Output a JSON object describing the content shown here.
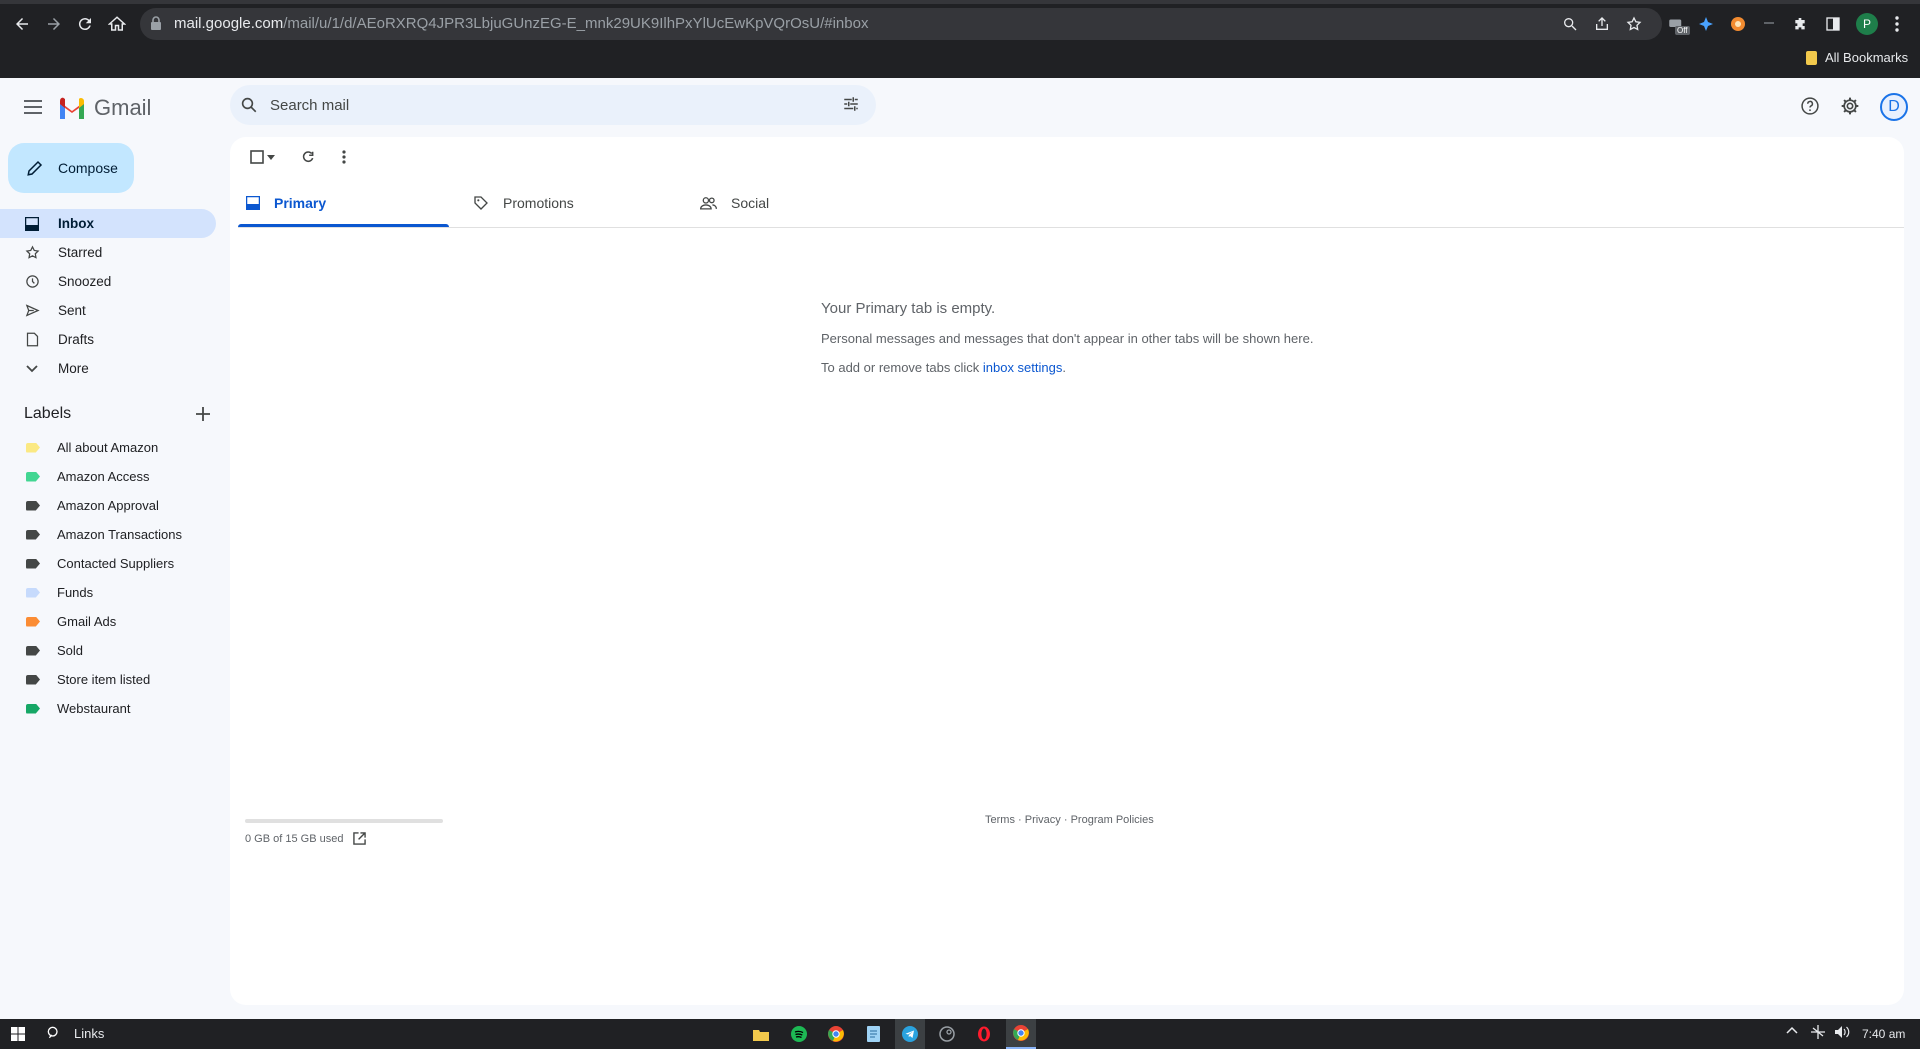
{
  "browser": {
    "url_host": "mail.google.com",
    "url_path": "/mail/u/1/d/AEoRXRQ4JPR3LbjuGUnzEG-E_mnk29UK9IlhPxYlUcEwKpVQrOsU/#inbox",
    "bookmarks_label": "All Bookmarks",
    "profile_initial": "P",
    "ext_badge": "Off"
  },
  "gmail": {
    "app_name": "Gmail",
    "search_placeholder": "Search mail",
    "account_initial": "D"
  },
  "sidebar": {
    "compose_label": "Compose",
    "items": [
      {
        "label": "Inbox",
        "icon": "inbox-icon",
        "active": true
      },
      {
        "label": "Starred",
        "icon": "star-icon"
      },
      {
        "label": "Snoozed",
        "icon": "clock-icon"
      },
      {
        "label": "Sent",
        "icon": "send-icon"
      },
      {
        "label": "Drafts",
        "icon": "draft-icon"
      },
      {
        "label": "More",
        "icon": "chevron-down-icon"
      }
    ],
    "labels_title": "Labels",
    "labels": [
      {
        "name": "All about Amazon",
        "color": "#fbe983"
      },
      {
        "name": "Amazon Access",
        "color": "#42d692"
      },
      {
        "name": "Amazon Approval",
        "color": "#444746"
      },
      {
        "name": "Amazon Transactions",
        "color": "#444746"
      },
      {
        "name": "Contacted Suppliers",
        "color": "#444746"
      },
      {
        "name": "Funds",
        "color": "#c6dafc"
      },
      {
        "name": "Gmail Ads",
        "color": "#fb8c34"
      },
      {
        "name": "Sold",
        "color": "#444746"
      },
      {
        "name": "Store item listed",
        "color": "#444746"
      },
      {
        "name": "Webstaurant",
        "color": "#16a766"
      }
    ]
  },
  "tabs": [
    {
      "label": "Primary",
      "icon": "inbox-tab-icon"
    },
    {
      "label": "Promotions",
      "icon": "tag-icon"
    },
    {
      "label": "Social",
      "icon": "people-icon"
    }
  ],
  "empty_state": {
    "title": "Your Primary tab is empty.",
    "line1": "Personal messages and messages that don't appear in other tabs will be shown here.",
    "line2_prefix": "To add or remove tabs click ",
    "line2_link": "inbox settings",
    "line2_suffix": "."
  },
  "footer": {
    "storage_text": "0 GB of 15 GB used",
    "storage_fraction": 0,
    "terms": "Terms",
    "privacy": "Privacy",
    "program_policies": "Program Policies",
    "separator": " · "
  },
  "taskbar": {
    "search_label": "Links",
    "time": "7:40 am"
  },
  "colors": {
    "accent": "#0b57d0",
    "compose_bg": "#c2e7ff",
    "active_nav_bg": "#d3e3fd"
  }
}
